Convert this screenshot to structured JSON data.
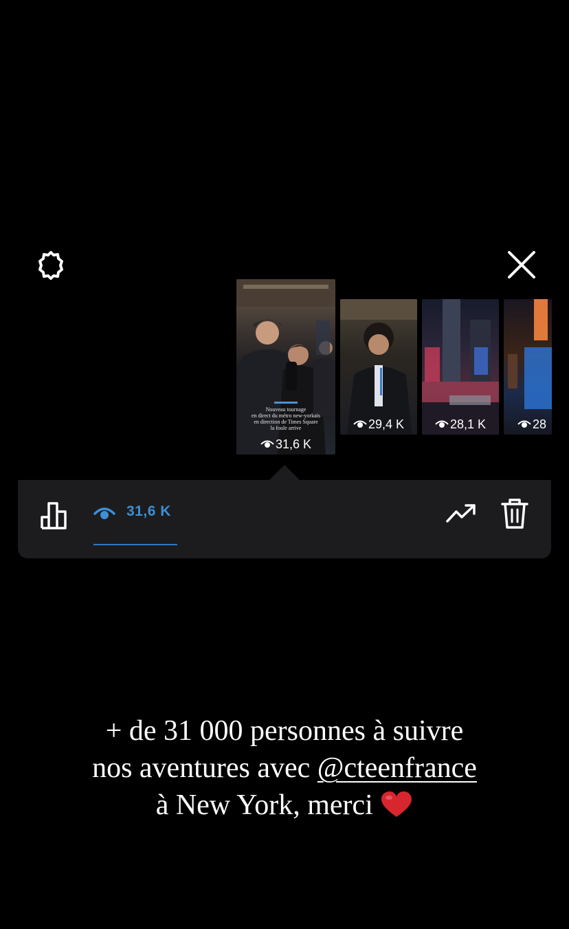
{
  "thumbnails": [
    {
      "views": "31,6 K",
      "selected": true,
      "caption_lines": [
        "Nouveau tournage",
        "en direct du métro new-yorkais",
        "en direction de Times Square",
        "la foule arrive"
      ]
    },
    {
      "views": "29,4 K",
      "selected": false
    },
    {
      "views": "28,1 K",
      "selected": false
    },
    {
      "views": "28",
      "selected": false
    }
  ],
  "insights_bar": {
    "views": "31,6 K",
    "accent_color": "#3d8fd6",
    "icons": [
      "bar-chart-icon",
      "eye-icon",
      "trend-up-icon",
      "trash-icon"
    ]
  },
  "top_icons": [
    "settings-gear-icon",
    "close-icon"
  ],
  "story_text": {
    "line1": "+ de 31 000 personnes à suivre",
    "line2_prefix": "nos aventures avec ",
    "mention": "@cteenfrance",
    "line3": "à New York, merci",
    "emoji": "red-heart"
  }
}
